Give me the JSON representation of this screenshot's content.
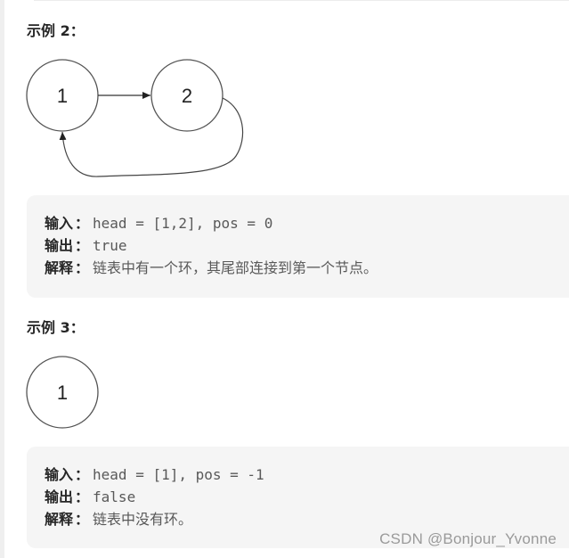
{
  "examples": [
    {
      "heading": "示例 2：",
      "diagram": {
        "nodes": [
          "1",
          "2"
        ],
        "edges": [
          [
            "1",
            "2"
          ],
          [
            "2",
            "1"
          ]
        ]
      },
      "input_label": "输入",
      "input_value": "head = [1,2], pos = 0",
      "output_label": "输出",
      "output_value": "true",
      "explain_label": "解释",
      "explain_value": "链表中有一个环，其尾部连接到第一个节点。"
    },
    {
      "heading": "示例 3：",
      "diagram": {
        "nodes": [
          "1"
        ],
        "edges": []
      },
      "input_label": "输入",
      "input_value": "head = [1], pos = -1",
      "output_label": "输出",
      "output_value": "false",
      "explain_label": "解释",
      "explain_value": "链表中没有环。"
    }
  ],
  "colon": "：",
  "watermark": "CSDN @Bonjour_Yvonne"
}
